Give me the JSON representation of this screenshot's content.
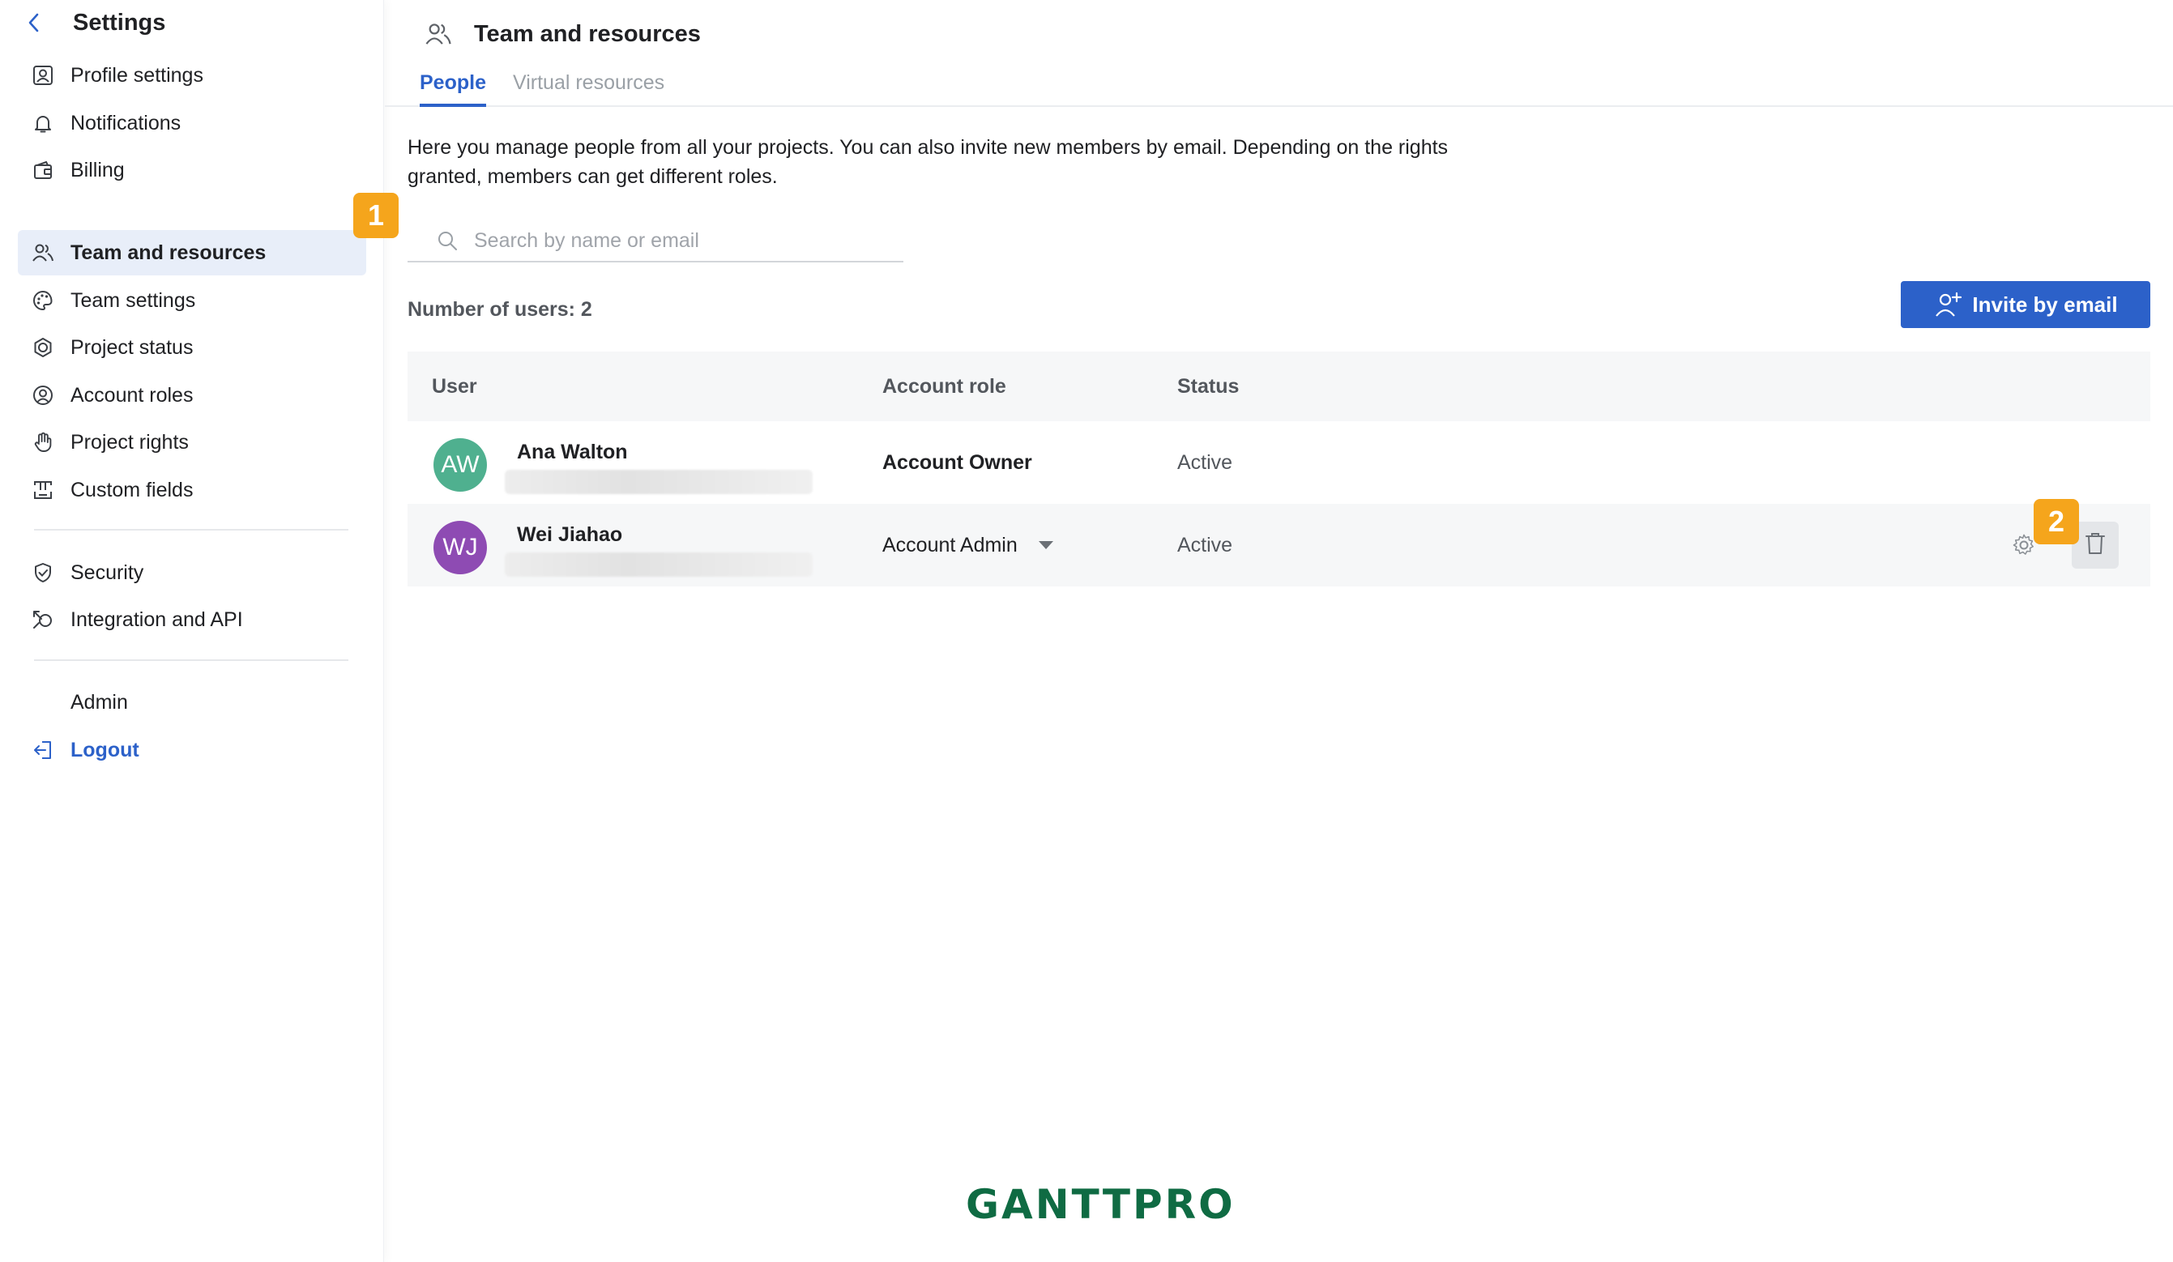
{
  "sidebar": {
    "title": "Settings",
    "items": [
      {
        "label": "Profile settings",
        "icon": "profile-icon"
      },
      {
        "label": "Notifications",
        "icon": "bell-icon"
      },
      {
        "label": "Billing",
        "icon": "wallet-icon"
      },
      {
        "label": "Team and resources",
        "icon": "people-icon",
        "active": true
      },
      {
        "label": "Team settings",
        "icon": "palette-icon"
      },
      {
        "label": "Project status",
        "icon": "status-icon"
      },
      {
        "label": "Account roles",
        "icon": "user-circle-icon"
      },
      {
        "label": "Project rights",
        "icon": "hand-icon"
      },
      {
        "label": "Custom fields",
        "icon": "custom-fields-icon"
      },
      {
        "label": "Security",
        "icon": "shield-icon"
      },
      {
        "label": "Integration and API",
        "icon": "integration-icon"
      },
      {
        "label": "Admin",
        "icon": ""
      },
      {
        "label": "Logout",
        "icon": "logout-icon"
      }
    ]
  },
  "badges": {
    "one": "1",
    "two": "2"
  },
  "header": {
    "title": "Team and resources",
    "icon": "people-icon"
  },
  "tabs": [
    {
      "label": "People",
      "active": true
    },
    {
      "label": "Virtual resources",
      "active": false
    }
  ],
  "description": "Here you manage people from all your projects. You can also invite new members by email. Depending on the rights granted, members can get different roles.",
  "search": {
    "placeholder": "Search by name or email",
    "value": ""
  },
  "count_label": "Number of users: 2",
  "invite_label": "Invite by email",
  "table": {
    "headers": {
      "user": "User",
      "role": "Account role",
      "status": "Status"
    },
    "rows": [
      {
        "initials": "AW",
        "name": "Ana Walton",
        "role": "Account Owner",
        "status": "Active",
        "avatar_color": "#4fb08f"
      },
      {
        "initials": "WJ",
        "name": "Wei Jiahao",
        "role": "Account Admin",
        "status": "Active",
        "avatar_color": "#8e4bb3"
      }
    ]
  },
  "colors": {
    "accent": "#2c61c9",
    "badge": "#f5a51c",
    "logo": "#0f6b43"
  },
  "logo": "GANTTPRO"
}
